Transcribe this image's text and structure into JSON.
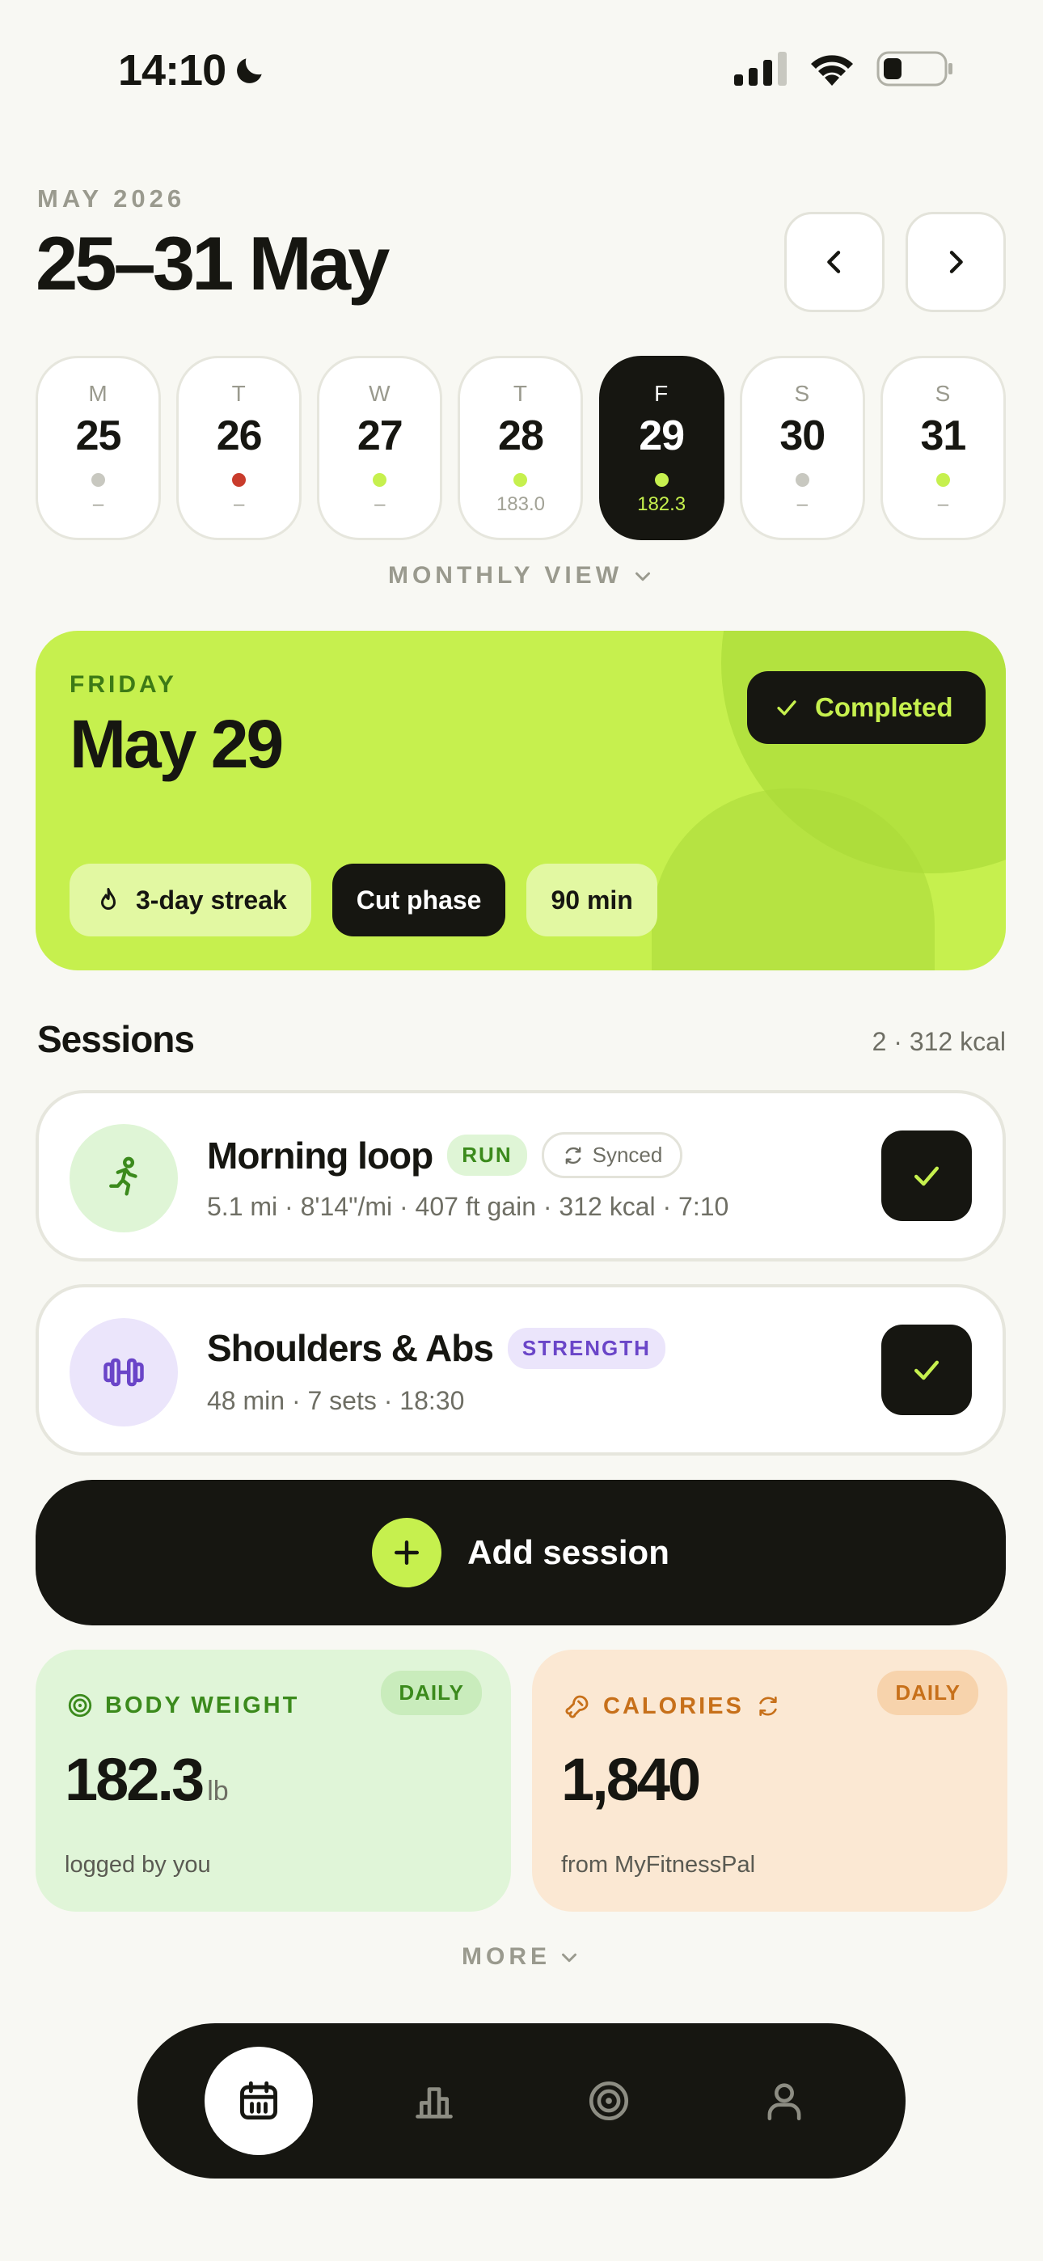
{
  "status": {
    "time": "14:10"
  },
  "header": {
    "eyebrow": "MAY 2026",
    "title": "25–31 May"
  },
  "week": [
    {
      "letter": "M",
      "num": "25",
      "dot": "#c8c8c0",
      "val": "–"
    },
    {
      "letter": "T",
      "num": "26",
      "dot": "#c93c2c",
      "val": "–"
    },
    {
      "letter": "W",
      "num": "27",
      "dot": "#c6f04e",
      "val": "–"
    },
    {
      "letter": "T",
      "num": "28",
      "dot": "#c6f04e",
      "val": "183.0"
    },
    {
      "letter": "F",
      "num": "29",
      "dot": "#c6f04e",
      "val": "182.3"
    },
    {
      "letter": "S",
      "num": "30",
      "dot": "#c8c8c0",
      "val": "–"
    },
    {
      "letter": "S",
      "num": "31",
      "dot": "#c6f04e",
      "val": "–"
    }
  ],
  "monthly_view": "MONTHLY VIEW",
  "hero": {
    "weekday": "FRIDAY",
    "date": "May 29",
    "badge": "Completed",
    "chips": [
      "3-day streak",
      "Cut phase",
      "90 min"
    ]
  },
  "sessions": {
    "title": "Sessions",
    "meta": "2 · 312 kcal",
    "items": [
      {
        "name": "Morning loop",
        "tag": "RUN",
        "synced": "Synced",
        "meta": "5.1 mi · 8'14\"/mi · 407 ft gain · 312 kcal · 7:10",
        "icon": "running-icon"
      },
      {
        "name": "Shoulders & Abs",
        "tag": "STRENGTH",
        "meta": "48 min · 7 sets · 18:30",
        "icon": "dumbbell-icon"
      }
    ]
  },
  "add_session": "Add session",
  "metrics": {
    "weight": {
      "label": "BODY WEIGHT",
      "badge": "DAILY",
      "value": "182.3",
      "unit": "lb",
      "foot": "logged by you"
    },
    "calories": {
      "label": "CALORIES",
      "badge": "DAILY",
      "value": "1,840",
      "foot": "from MyFitnessPal"
    }
  },
  "more": "MORE",
  "colors": {
    "accent": "#c6f04e",
    "dark": "#161611",
    "background": "#f8f8f3"
  },
  "tabs": [
    "calendar-icon",
    "bar-chart-icon",
    "target-icon",
    "profile-icon"
  ]
}
